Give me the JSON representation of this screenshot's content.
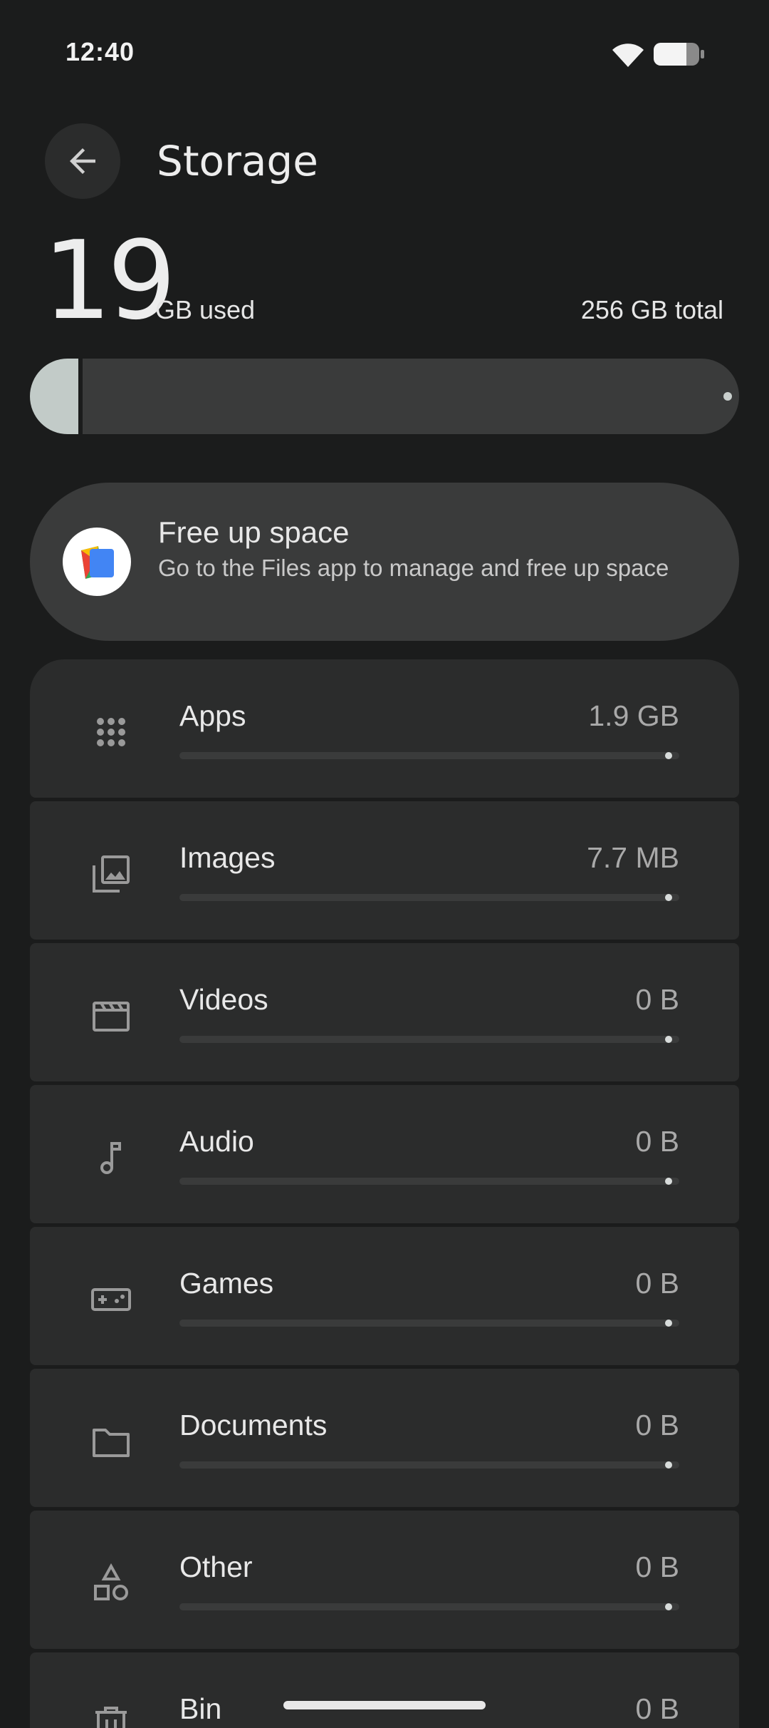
{
  "status_bar": {
    "time": "12:40",
    "wifi_icon": "wifi-icon",
    "battery_icon": "battery-icon"
  },
  "app_bar": {
    "title": "Storage",
    "back_icon": "arrow-back-icon"
  },
  "usage": {
    "used_number": "19",
    "used_unit": "GB used",
    "total": "256 GB total",
    "used_fraction": 0.074
  },
  "free_up": {
    "title": "Free up space",
    "description": "Go to the Files app to manage and free up space",
    "icon": "files-app-icon"
  },
  "categories": [
    {
      "name": "Apps",
      "size": "1.9 GB",
      "icon": "apps-grid-icon"
    },
    {
      "name": "Images",
      "size": "7.7 MB",
      "icon": "images-icon"
    },
    {
      "name": "Videos",
      "size": "0 B",
      "icon": "videos-icon"
    },
    {
      "name": "Audio",
      "size": "0 B",
      "icon": "audio-icon"
    },
    {
      "name": "Games",
      "size": "0 B",
      "icon": "games-icon"
    },
    {
      "name": "Documents",
      "size": "0 B",
      "icon": "folder-icon"
    },
    {
      "name": "Other",
      "size": "0 B",
      "icon": "shapes-icon"
    },
    {
      "name": "Bin",
      "size": "0 B",
      "icon": "trash-icon"
    }
  ],
  "colors": {
    "background": "#1b1c1c",
    "surface": "#2b2c2c",
    "surface_high": "#3a3b3b",
    "accent": "#c2cbc8"
  }
}
